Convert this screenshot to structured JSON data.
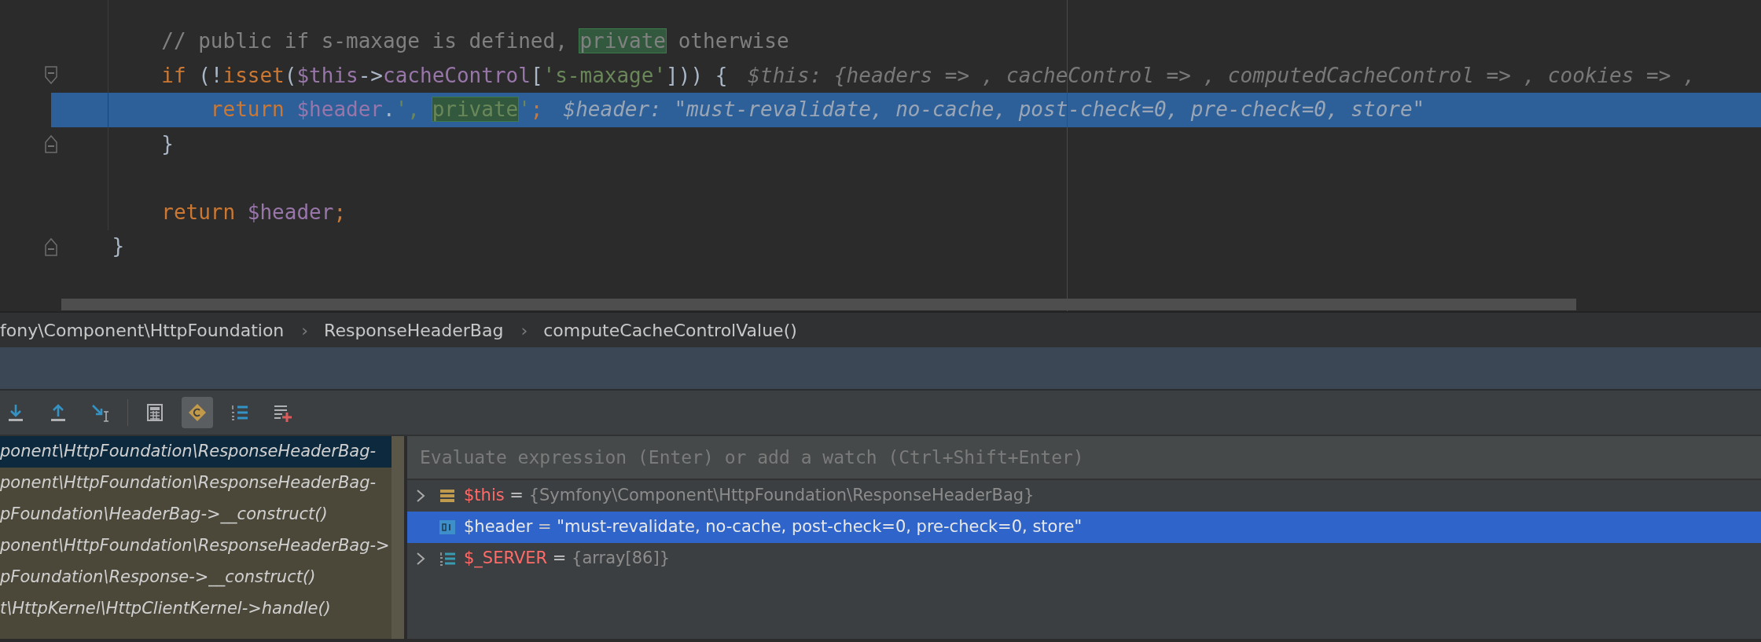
{
  "editor": {
    "lines": [
      {
        "kind": "plain",
        "current": false,
        "tokens": [
          {
            "kind": "comment",
            "text": "        // public if s-maxage is defined, "
          },
          {
            "kind": "comment-match",
            "text": "private"
          },
          {
            "kind": "comment",
            "text": " otherwise"
          }
        ]
      },
      {
        "kind": "fold-start",
        "current": false,
        "tokens": [
          {
            "kind": "keyword",
            "text": "        if "
          },
          {
            "kind": "plain",
            "text": "(!"
          },
          {
            "kind": "keyword",
            "text": "isset"
          },
          {
            "kind": "plain",
            "text": "("
          },
          {
            "kind": "var",
            "text": "$this"
          },
          {
            "kind": "plain",
            "text": "->"
          },
          {
            "kind": "var",
            "text": "cacheControl"
          },
          {
            "kind": "plain",
            "text": "["
          },
          {
            "kind": "string",
            "text": "'s-maxage'"
          },
          {
            "kind": "plain",
            "text": "])) {"
          }
        ],
        "hint": "$this: {headers => , cacheControl => , computedCacheControl => , cookies => , "
      },
      {
        "kind": "plain",
        "current": true,
        "tokens": [
          {
            "kind": "keyword",
            "text": "            return "
          },
          {
            "kind": "var",
            "text": "$header"
          },
          {
            "kind": "plain",
            "text": "."
          },
          {
            "kind": "string",
            "text": "', "
          },
          {
            "kind": "string-match",
            "text": "private"
          },
          {
            "kind": "string",
            "text": "'"
          },
          {
            "kind": "keyword",
            "text": ";"
          }
        ],
        "hint": "$header: \"must-revalidate, no-cache, post-check=0, pre-check=0, store\""
      },
      {
        "kind": "fold-end",
        "current": false,
        "tokens": [
          {
            "kind": "plain",
            "text": "        }"
          }
        ]
      },
      {
        "kind": "plain",
        "current": false
      },
      {
        "kind": "plain",
        "current": false,
        "tokens": [
          {
            "kind": "keyword",
            "text": "        return "
          },
          {
            "kind": "var",
            "text": "$header"
          },
          {
            "kind": "keyword",
            "text": ";"
          }
        ]
      },
      {
        "kind": "fold-end",
        "current": false,
        "tokens": [
          {
            "kind": "plain",
            "text": "    }"
          }
        ]
      }
    ]
  },
  "breadcrumbs": [
    {
      "text": "fony\\Component\\HttpFoundation"
    },
    {
      "separator": "›",
      "text": "ResponseHeaderBag"
    },
    {
      "separator": "›",
      "text": "computeCacheControlValue()"
    }
  ],
  "toolbar": [
    {
      "kind": "step-into",
      "selected": false
    },
    {
      "kind": "step-out",
      "selected": false
    },
    {
      "kind": "run-to-cursor",
      "selected": false
    },
    {
      "kind": "separator"
    },
    {
      "kind": "evaluate",
      "selected": false
    },
    {
      "kind": "class-filter",
      "selected": true
    },
    {
      "kind": "numbered-list",
      "selected": false
    },
    {
      "kind": "add-watch",
      "selected": false
    }
  ],
  "frames": [
    {
      "text": "ponent\\HttpFoundation\\ResponseHeaderBag-",
      "selected": true
    },
    {
      "text": "ponent\\HttpFoundation\\ResponseHeaderBag-",
      "selected": false
    },
    {
      "text": "pFoundation\\HeaderBag->__construct()",
      "selected": false
    },
    {
      "text": "ponent\\HttpFoundation\\ResponseHeaderBag->",
      "selected": false
    },
    {
      "text": "pFoundation\\Response->__construct()",
      "selected": false
    },
    {
      "text": "t\\HttpKernel\\HttpClientKernel->handle()",
      "selected": false
    }
  ],
  "evaluate": {
    "placeholder": "Evaluate expression (Enter) or add a watch (Ctrl+Shift+Enter)"
  },
  "variables": [
    {
      "kind": "object",
      "expandable": true,
      "selected": false,
      "name": "$this",
      "equals": "=",
      "value": "{Symfony\\Component\\HttpFoundation\\ResponseHeaderBag}"
    },
    {
      "kind": "string",
      "expandable": false,
      "selected": true,
      "name": "$header",
      "equals": "=",
      "value": "\"must-revalidate, no-cache, post-check=0, pre-check=0, store\""
    },
    {
      "kind": "array",
      "expandable": true,
      "selected": false,
      "name": "$_SERVER",
      "equals": "=",
      "value": "{array[86]}"
    }
  ]
}
